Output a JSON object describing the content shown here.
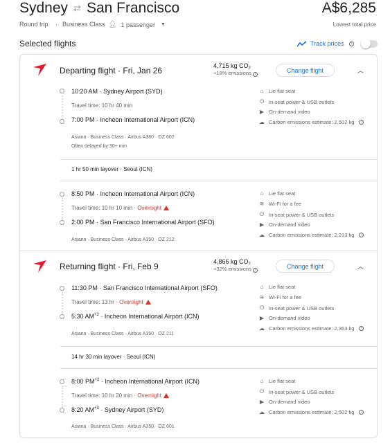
{
  "header": {
    "origin": "Sydney",
    "destination": "San Francisco",
    "price": "A$6,285",
    "trip_type": "Round trip",
    "cabin_class": "Business Class",
    "passengers": "1 passenger",
    "price_note": "Lowest total price"
  },
  "section_title": "Selected flights",
  "track_prices_label": "Track prices",
  "change_flight_label": "Change flight",
  "departing": {
    "heading": "Departing flight · Fri, Jan 26",
    "co2": "4,715 kg CO₂",
    "emissions": "+18% emissions",
    "leg1": {
      "dep_time": "10:20 AM",
      "dep_airport": "Sydney Airport (SYD)",
      "travel_time": "Travel time: 10 hr 40 min",
      "arr_time": "7:00 PM",
      "arr_airport": "Incheon International Airport (ICN)",
      "details": "Asiana · Business Class · Airbus A380 · OZ 602",
      "delay": "Often delayed by 30+ min",
      "amenities": [
        "Lie flat seat",
        "In-seat power & USB outlets",
        "On-demand video",
        "Carbon emissions estimate: 2,502 kg"
      ]
    },
    "layover": "1 hr 50 min layover · Seoul (ICN)",
    "leg2": {
      "dep_time": "8:50 PM",
      "dep_airport": "Incheon International Airport (ICN)",
      "travel_time": "Travel time: 10 hr 10 min",
      "overnight": "Overnight",
      "arr_time": "2:00 PM",
      "arr_airport": "San Francisco International Airport (SFO)",
      "details": "Asiana · Business Class · Airbus A350 · OZ 212",
      "amenities": [
        "Lie flat seat",
        "Wi-Fi for a fee",
        "In-seat power & USB outlets",
        "On-demand video",
        "Carbon emissions estimate: 2,213 kg"
      ]
    }
  },
  "returning": {
    "heading": "Returning flight · Fri, Feb 9",
    "co2": "4,866 kg CO₂",
    "emissions": "+32% emissions",
    "leg1": {
      "dep_time": "11:30 PM",
      "dep_airport": "San Francisco International Airport (SFO)",
      "travel_time": "Travel time: 13 hr",
      "overnight": "Overnight",
      "arr_time": "5:30 AM",
      "arr_sup": "+2",
      "arr_airport": "Incheon International Airport (ICN)",
      "details": "Asiana · Business Class · Airbus A350 · OZ 211",
      "amenities": [
        "Lie flat seat",
        "Wi-Fi for a fee",
        "In-seat power & USB outlets",
        "On-demand video",
        "Carbon emissions estimate: 2,363 kg"
      ]
    },
    "layover": "14 hr 30 min layover · Seoul (ICN)",
    "leg2": {
      "dep_time": "8:00 PM",
      "dep_sup": "+2",
      "dep_airport": "Incheon International Airport (ICN)",
      "travel_time": "Travel time: 10 hr 20 min",
      "overnight": "Overnight",
      "arr_time": "8:20 AM",
      "arr_sup": "+3",
      "arr_airport": "Sydney Airport (SYD)",
      "details": "Asiana · Business Class · Airbus A350 · OZ 601",
      "amenities": [
        "Lie flat seat",
        "In-seat power & USB outlets",
        "On-demand video",
        "Carbon emissions estimate: 2,502 kg"
      ]
    }
  },
  "icons": {
    "airline_logo": "asiana-logo",
    "swap": "swap-arrows-icon",
    "person": "person-icon",
    "track": "trend-icon",
    "seat": "seat-icon",
    "wifi": "wifi-icon",
    "power": "power-icon",
    "video": "video-icon",
    "co2": "co2-icon"
  },
  "colors": {
    "accent": "#1a73e8",
    "warning": "#d93025",
    "logo": "#e8182f"
  }
}
